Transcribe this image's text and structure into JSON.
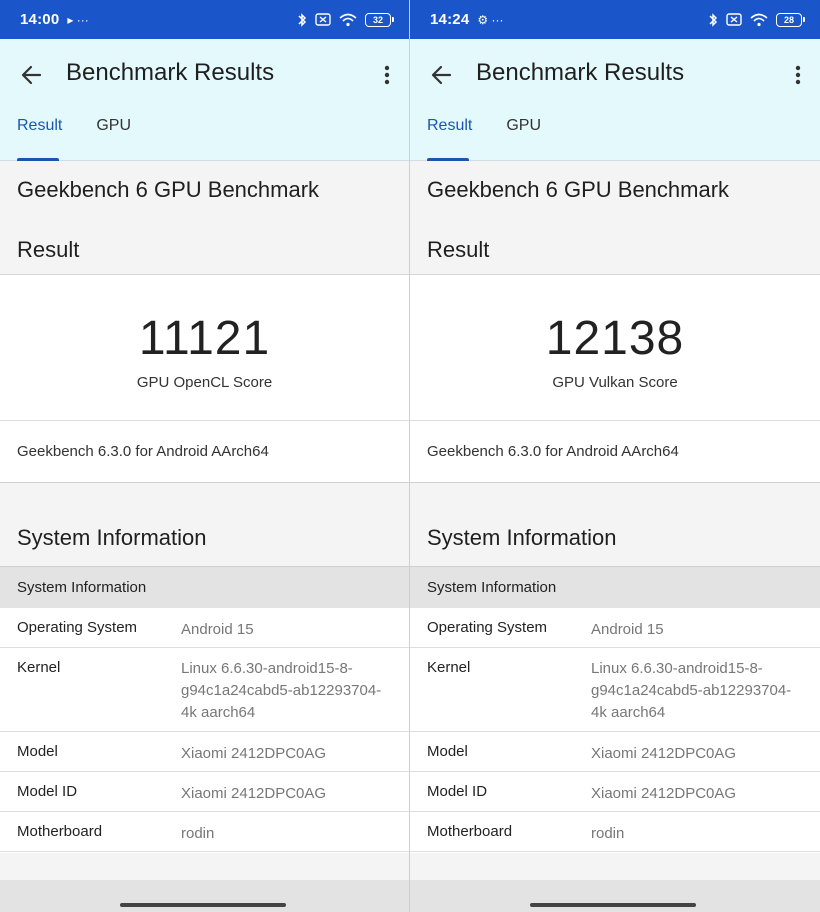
{
  "left": {
    "status": {
      "time": "14:00",
      "extra": "▸ ···",
      "battery": "32"
    },
    "appbar": {
      "title": "Benchmark Results"
    },
    "tabs": [
      {
        "label": "Result"
      },
      {
        "label": "GPU"
      }
    ],
    "header": {
      "title": "Geekbench 6 GPU Benchmark",
      "subtitle": "Result"
    },
    "score": {
      "value": "11121",
      "label": "GPU OpenCL Score"
    },
    "version": "Geekbench 6.3.0 for Android AArch64",
    "sysinfo": {
      "title": "System Information",
      "subheader": "System Information",
      "rows": [
        {
          "key": "Operating System",
          "value": "Android 15"
        },
        {
          "key": "Kernel",
          "value": "Linux 6.6.30-android15-8-g94c1a24cabd5-ab12293704-4k aarch64"
        },
        {
          "key": "Model",
          "value": "Xiaomi 2412DPC0AG"
        },
        {
          "key": "Model ID",
          "value": "Xiaomi 2412DPC0AG"
        },
        {
          "key": "Motherboard",
          "value": "rodin"
        }
      ]
    }
  },
  "right": {
    "status": {
      "time": "14:24",
      "extra": "⚙ ···",
      "battery": "28"
    },
    "appbar": {
      "title": "Benchmark Results"
    },
    "tabs": [
      {
        "label": "Result"
      },
      {
        "label": "GPU"
      }
    ],
    "header": {
      "title": "Geekbench 6 GPU Benchmark",
      "subtitle": "Result"
    },
    "score": {
      "value": "12138",
      "label": "GPU Vulkan Score"
    },
    "version": "Geekbench 6.3.0 for Android AArch64",
    "sysinfo": {
      "title": "System Information",
      "subheader": "System Information",
      "rows": [
        {
          "key": "Operating System",
          "value": "Android 15"
        },
        {
          "key": "Kernel",
          "value": "Linux 6.6.30-android15-8-g94c1a24cabd5-ab12293704-4k aarch64"
        },
        {
          "key": "Model",
          "value": "Xiaomi 2412DPC0AG"
        },
        {
          "key": "Model ID",
          "value": "Xiaomi 2412DPC0AG"
        },
        {
          "key": "Motherboard",
          "value": "rodin"
        }
      ]
    }
  },
  "colors": {
    "statusbar": "#1a56c9",
    "appbar": "#e4f9fb",
    "accent": "#1a56b0"
  },
  "icons": [
    "back-arrow-icon",
    "overflow-menu-icon",
    "bluetooth-icon",
    "sim-off-icon",
    "wifi-icon",
    "battery-icon"
  ]
}
